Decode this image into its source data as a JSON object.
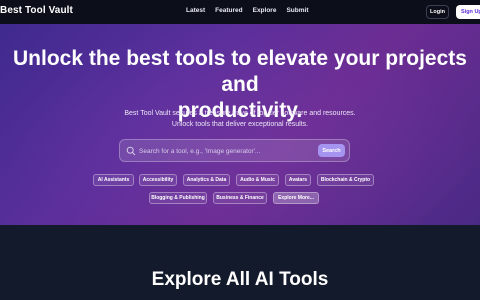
{
  "nav": {
    "brand": "Best Tool Vault",
    "links": [
      "Latest",
      "Featured",
      "Explore",
      "Submit"
    ],
    "login_label": "Login",
    "signup_label": "Sign Up"
  },
  "hero": {
    "headline_line1": "Unlock the best tools to elevate your projects and",
    "headline_line2": "productivity.",
    "sub_line1": "Best Tool Vault secures a treasure trove of top tier software and resources.",
    "sub_line2": "Unlock tools that deliver exceptional results.",
    "search": {
      "placeholder": "Search for a tool, e.g., 'Image generator'...",
      "button_label": "Search"
    },
    "chips": [
      "AI Assistants",
      "Accessibility",
      "Analytics & Data",
      "Audio & Music",
      "Avatars",
      "Blockchain & Crypto",
      "Blogging & Publishing",
      "Business & Finance",
      "Explore More..."
    ]
  },
  "section": {
    "title": "Explore All AI Tools"
  },
  "colors": {
    "accent": "#a594f0",
    "hero_gradient_start": "#3f2a8e",
    "hero_gradient_mid": "#6c2d93",
    "page_background": "#141a2b",
    "nav_background": "#0c0f1a"
  }
}
